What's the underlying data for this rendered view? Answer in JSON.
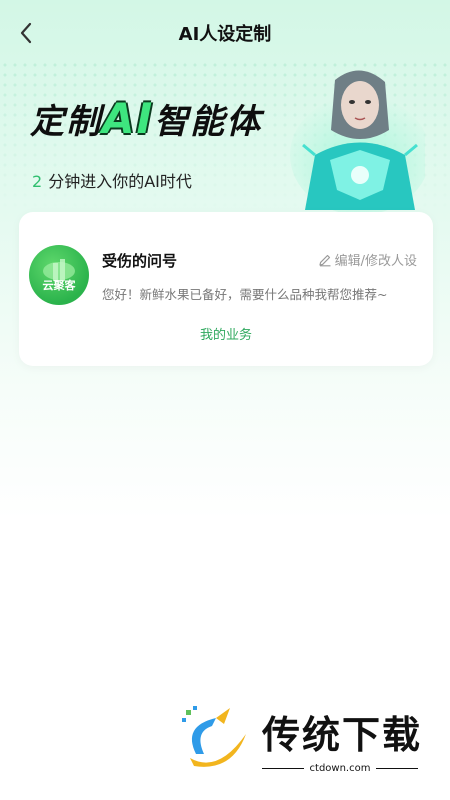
{
  "header": {
    "title": "AI人设定制",
    "back_icon": "chevron-left-icon"
  },
  "hero": {
    "title_prefix": "定制",
    "title_ai": "AI",
    "title_suffix": "智能体",
    "subtitle_num": "2",
    "subtitle_text": "分钟进入你的AI时代",
    "accent_color": "#3ee67f"
  },
  "card": {
    "avatar_text": "云聚客",
    "name": "受伤的问号",
    "edit_label": "编辑/修改人设",
    "edit_icon": "pencil-icon",
    "greeting": "您好！新鲜水果已备好，需要什么品种我帮您推荐~",
    "business_link": "我的业务",
    "link_color": "#2fa85e"
  },
  "watermark": {
    "text": "传统下载",
    "url": "ctdown.com"
  }
}
